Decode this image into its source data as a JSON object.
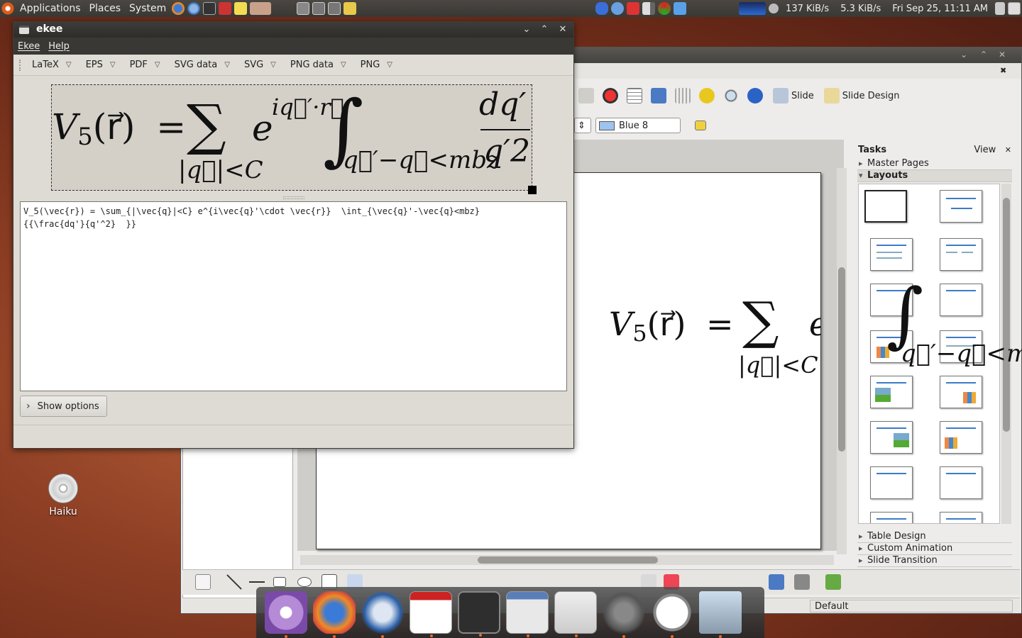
{
  "top_panel": {
    "menus": [
      "Applications",
      "Places",
      "System"
    ],
    "net_down": "137 KiB/s",
    "net_up": "5.3 KiB/s",
    "clock": "Fri Sep 25, 11:11 AM"
  },
  "desktop": {
    "icon_label": "Haiku"
  },
  "impress": {
    "toolbar_slide_label": "Slide",
    "toolbar_slide_design_label": "Slide Design",
    "fill_color_value": "Blue 8",
    "status_layout": "Default",
    "tasks": {
      "title": "Tasks",
      "view_label": "View",
      "sections_top": [
        "Master Pages",
        "Layouts"
      ],
      "sections_bottom": [
        "Table Design",
        "Custom Animation",
        "Slide Transition"
      ]
    }
  },
  "ekee": {
    "title": "ekee",
    "menu": [
      "Ekee",
      "Help"
    ],
    "formats": [
      "LaTeX",
      "EPS",
      "PDF",
      "SVG data",
      "SVG",
      "PNG data",
      "PNG"
    ],
    "latex_source": "V_5(\\vec{r}) = \\sum_{|\\vec{q}|<C} e^{i\\vec{q}'\\cdot \\vec{r}}  \\int_{\\vec{q}'-\\vec{q}<mbz}\n{{\\frac{dq'}{q'^2}  }}",
    "show_options_label": "Show options"
  },
  "formula": {
    "lhs": "V",
    "lhs_sub": "5",
    "lhs_arg": "(r⃗)",
    "equals": "=",
    "sum_symbol": "∑",
    "sum_limit": "|q⃗|<C",
    "exp_base": "e",
    "exp_power": "iq⃗′·r⃗",
    "integral_symbol": "∫",
    "integral_limit": "q⃗′−q⃗<mbz",
    "frac_num": "dq′",
    "frac_den": "q′2"
  },
  "colors": {
    "accent_blue": "#3c7bc9",
    "desktop_orange": "#b8613a",
    "panel_dark": "#3a3834"
  }
}
